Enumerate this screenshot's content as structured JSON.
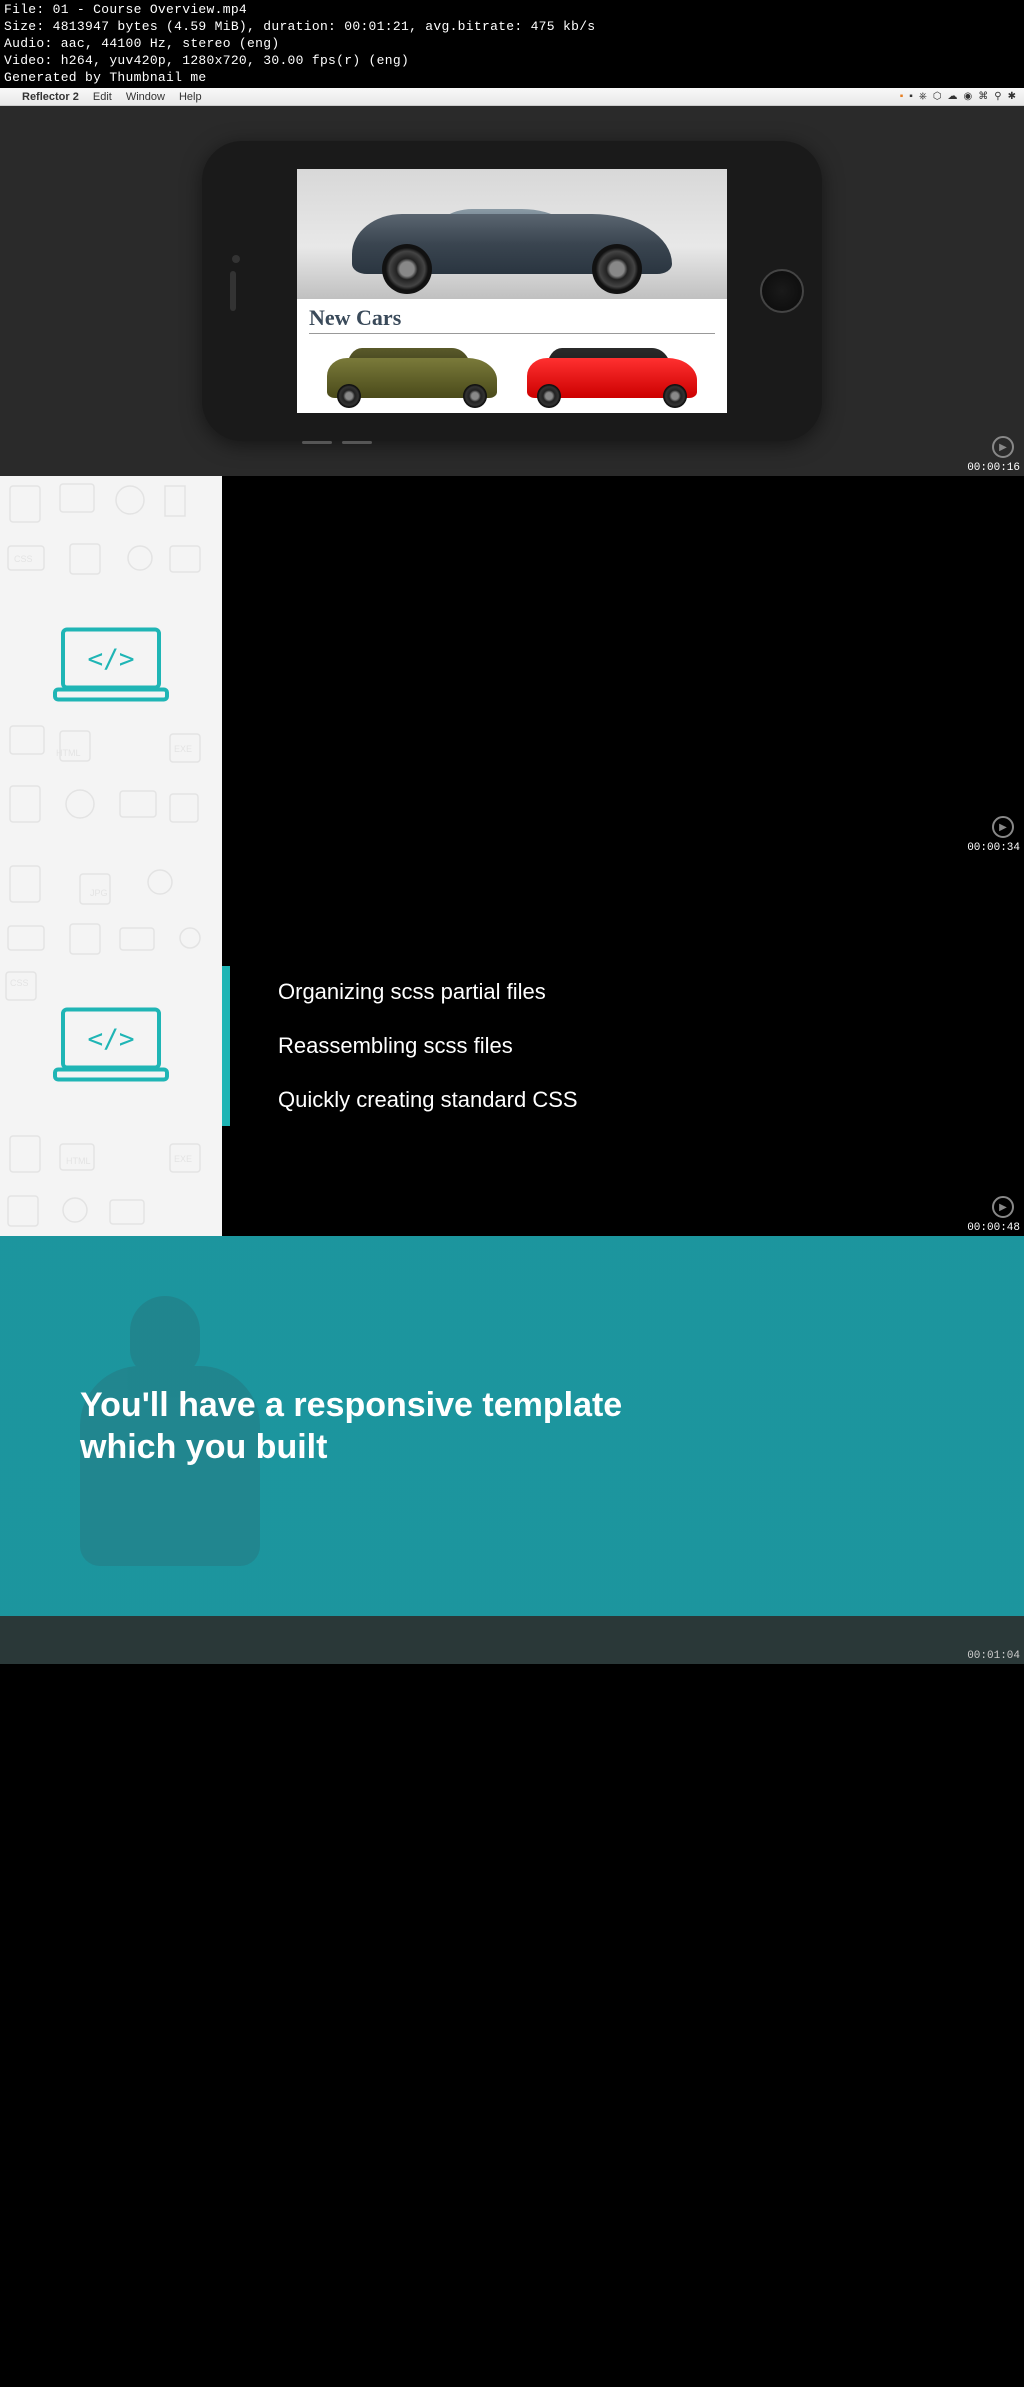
{
  "meta": {
    "file_label": "File: 01 - Course Overview.mp4",
    "size_label": "Size: 4813947 bytes (4.59 MiB), duration: 00:01:21, avg.bitrate: 475 kb/s",
    "audio_label": "Audio: aac, 44100 Hz, stereo (eng)",
    "video_label": "Video: h264, yuv420p, 1280x720, 30.00 fps(r) (eng)",
    "generated_label": "Generated by Thumbnail me"
  },
  "mac_menu": {
    "app": "Reflector 2",
    "items": [
      "Edit",
      "Window",
      "Help"
    ]
  },
  "panel1": {
    "heading": "New Cars",
    "timestamp": "00:00:16"
  },
  "panel2": {
    "timestamp": "00:00:34"
  },
  "panel3": {
    "line1": "Organizing scss partial files",
    "line2": "Reassembling scss files",
    "line3": "Quickly creating standard CSS",
    "timestamp": "00:00:48"
  },
  "panel4": {
    "text": "You'll have a responsive template which you built",
    "timestamp": "00:01:04"
  },
  "colors": {
    "teal": "#1fb5b5",
    "dark": "#2a2a2a"
  }
}
